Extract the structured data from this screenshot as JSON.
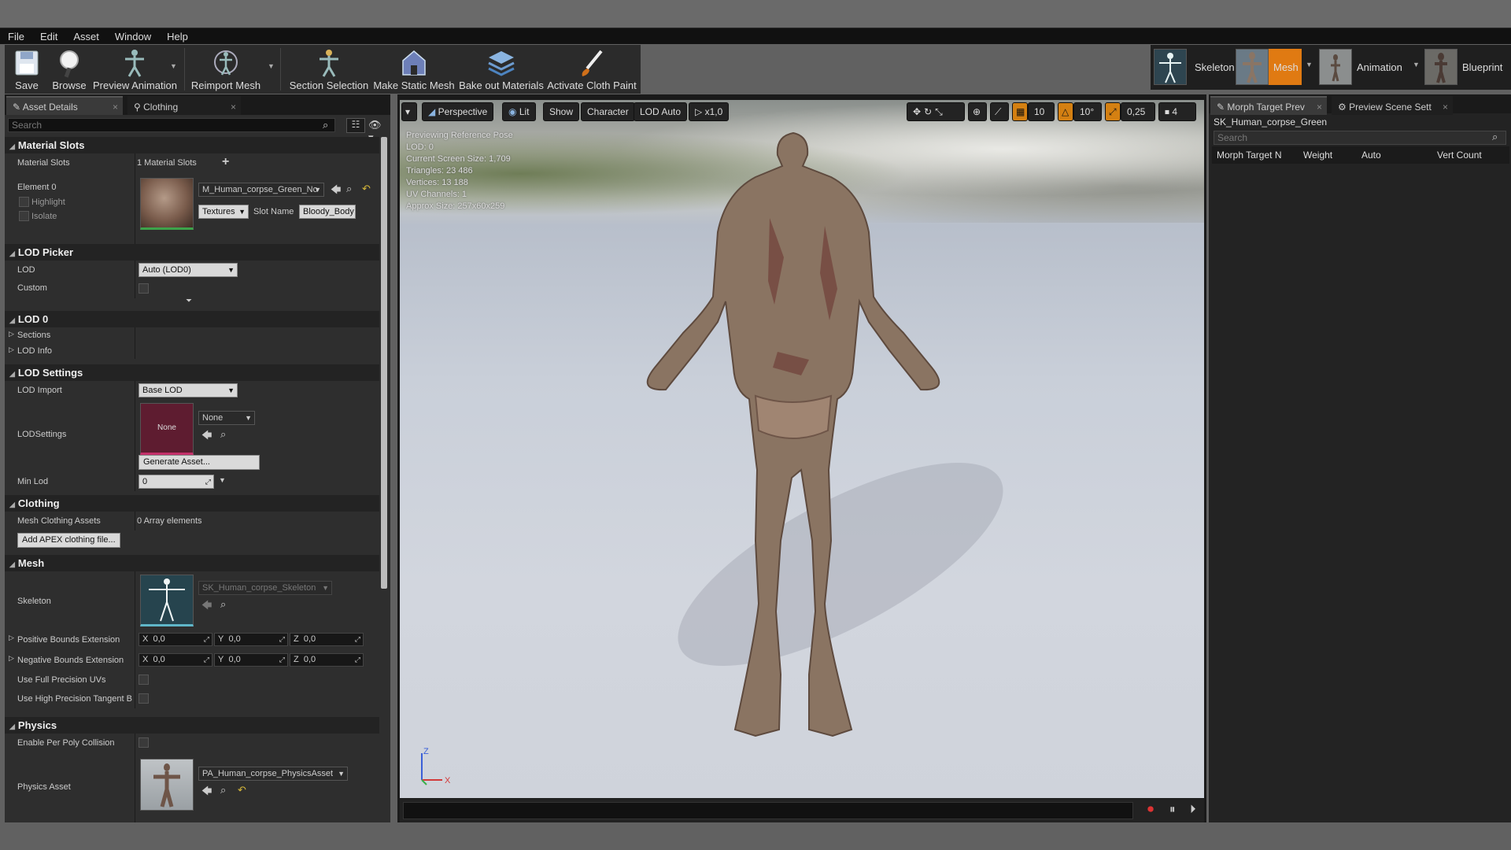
{
  "menu": [
    "File",
    "Edit",
    "Asset",
    "Window",
    "Help"
  ],
  "toolbar": {
    "save": "Save",
    "browse": "Browse",
    "preview_animation": "Preview Animation",
    "reimport_mesh": "Reimport Mesh",
    "section_selection": "Section Selection",
    "make_static_mesh": "Make Static Mesh",
    "bake_out_materials": "Bake out Materials",
    "activate_cloth_paint": "Activate Cloth Paint"
  },
  "modes": {
    "skeleton": "Skeleton",
    "mesh": "Mesh",
    "animation": "Animation",
    "blueprint": "Blueprint"
  },
  "left_tabs": {
    "asset_details": "Asset Details",
    "clothing": "Clothing"
  },
  "search_placeholder": "Search",
  "material_slots": {
    "header": "Material Slots",
    "row_label": "Material Slots",
    "count": "1 Material Slots",
    "element": "Element 0",
    "highlight": "Highlight",
    "isolate": "Isolate",
    "material": "M_Human_corpse_Green_No",
    "textures": "Textures",
    "slot_name_label": "Slot Name",
    "slot_name": "Bloody_Body"
  },
  "lod_picker": {
    "header": "LOD Picker",
    "lod_label": "LOD",
    "lod_value": "Auto (LOD0)",
    "custom_label": "Custom"
  },
  "lod0": {
    "header": "LOD 0",
    "sections": "Sections",
    "lod_info": "LOD Info"
  },
  "lod_settings": {
    "header": "LOD Settings",
    "lod_import_label": "LOD Import",
    "lod_import_value": "Base LOD",
    "lodsettings_label": "LODSettings",
    "none_thumb": "None",
    "none_value": "None",
    "generate_asset": "Generate Asset...",
    "min_lod_label": "Min Lod",
    "min_lod_value": "0"
  },
  "clothing": {
    "header": "Clothing",
    "mesh_clothing_label": "Mesh Clothing Assets",
    "mesh_clothing_value": "0 Array elements",
    "add_apex": "Add APEX clothing file..."
  },
  "mesh": {
    "header": "Mesh",
    "skeleton_label": "Skeleton",
    "skeleton_value": "SK_Human_corpse_Skeleton",
    "positive_bounds": "Positive Bounds Extension",
    "negative_bounds": "Negative Bounds Extension",
    "x_label": "X",
    "y_label": "Y",
    "z_label": "Z",
    "pos_x": "0,0",
    "pos_y": "0,0",
    "pos_z": "0,0",
    "neg_x": "0,0",
    "neg_y": "0,0",
    "neg_z": "0,0",
    "full_precision_uvs": "Use Full Precision UVs",
    "high_precision_tangent": "Use High Precision Tangent B"
  },
  "physics": {
    "header": "Physics",
    "per_poly_label": "Enable Per Poly Collision",
    "physics_asset_label": "Physics Asset",
    "physics_asset_value": "PA_Human_corpse_PhysicsAsset"
  },
  "viewport": {
    "perspective": "Perspective",
    "lit": "Lit",
    "show": "Show",
    "character": "Character",
    "lod_auto": "LOD Auto",
    "speed": "x1,0",
    "grid_snap": "10",
    "rot_snap": "10°",
    "scale_snap": "0,25",
    "cam_speed": "4",
    "info": [
      "Previewing Reference Pose",
      "LOD: 0",
      "Current Screen Size: 1,709",
      "Triangles: 23 486",
      "Vertices: 13 188",
      "UV Channels: 1",
      "Approx Size: 257x60x259"
    ],
    "axis_z": "Z",
    "axis_x": "X"
  },
  "right_panel": {
    "tab1": "Morph Target Prev",
    "tab2": "Preview Scene Sett",
    "asset_name": "SK_Human_corpse_Green",
    "search_placeholder": "Search",
    "columns": [
      "Morph Target N",
      "Weight",
      "Auto",
      "Vert Count"
    ]
  },
  "colors": {
    "accent_orange": "#e07a12",
    "panel_bg": "#2e2e2e",
    "category_bg": "#232323"
  }
}
